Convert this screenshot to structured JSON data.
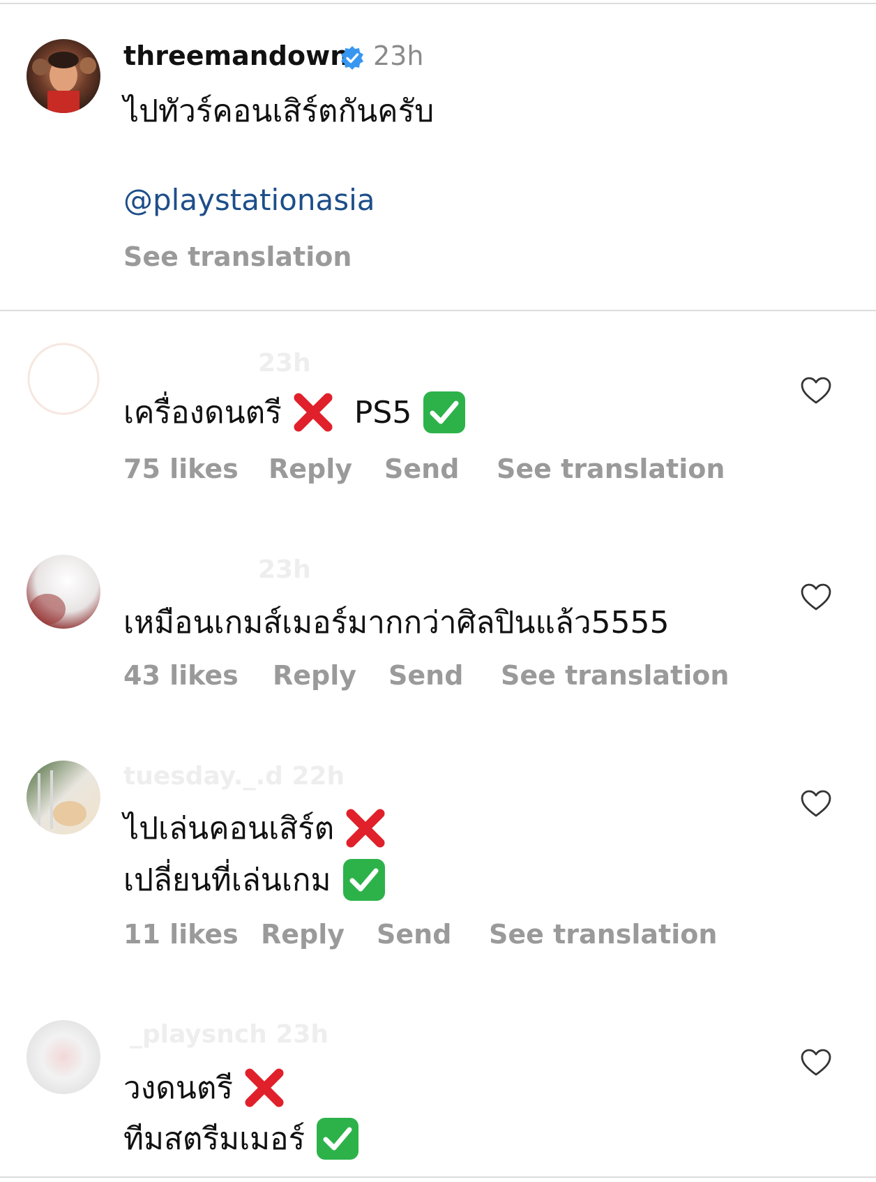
{
  "caption": {
    "username": "threemandown",
    "verified_icon": "verified-badge-icon",
    "time": "23h",
    "text": "ไปทัวร์คอนเสิร์ตกันครับ",
    "mention": "@playstationasia",
    "see_translation": "See translation"
  },
  "comments": [
    {
      "username_faded": "23h",
      "line1": "เครื่องดนตรี",
      "line1_suffix": "PS5",
      "likes": "75 likes",
      "reply": "Reply",
      "send": "Send",
      "see_translation": "See translation"
    },
    {
      "username_faded": "23h",
      "line1": "เหมือนเกมส์เมอร์มากกว่าศิลปินแล้ว5555",
      "likes": "43 likes",
      "reply": "Reply",
      "send": "Send",
      "see_translation": "See translation"
    },
    {
      "username_faded": "tuesday._.d 22h",
      "line1": "ไปเล่นคอนเสิร์ต",
      "line2": "เปลี่ยนที่เล่นเกม",
      "likes": "11 likes",
      "reply": "Reply",
      "send": "Send",
      "see_translation": "See translation"
    },
    {
      "username_faded": "_playsnch 23h",
      "line1": "วงดนตรี",
      "line2": "ทีมสตรีมเมอร์"
    }
  ],
  "colors": {
    "text": "#111111",
    "muted": "#9a9a9a",
    "mention": "#1d4e89",
    "verified": "#3797f0",
    "x_red": "#e0202a",
    "check_green": "#2db24a",
    "divider": "#dcdcdc"
  },
  "icons": {
    "like": "heart-outline-icon",
    "cross": "cross-mark-emoji",
    "check": "check-mark-button-emoji"
  }
}
